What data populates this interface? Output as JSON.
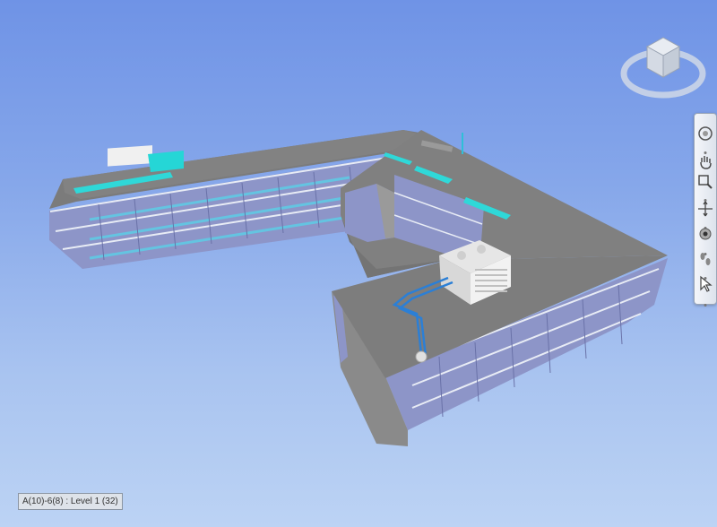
{
  "viewport": {
    "background_top": "#6f93e6",
    "background_bottom": "#bcd3f4"
  },
  "viewcube": {
    "icon": "view-cube-icon"
  },
  "navigation_bar": {
    "buttons": [
      {
        "icon": "full-navigation-wheel-icon"
      },
      {
        "icon": "pan-hand-icon"
      },
      {
        "icon": "zoom-icon"
      },
      {
        "icon": "orbit-icon"
      },
      {
        "icon": "look-icon"
      },
      {
        "icon": "walk-icon"
      },
      {
        "icon": "select-cursor-icon"
      }
    ]
  },
  "status": {
    "selection_label": "A(10)-6(8) : Level 1 (32)"
  }
}
